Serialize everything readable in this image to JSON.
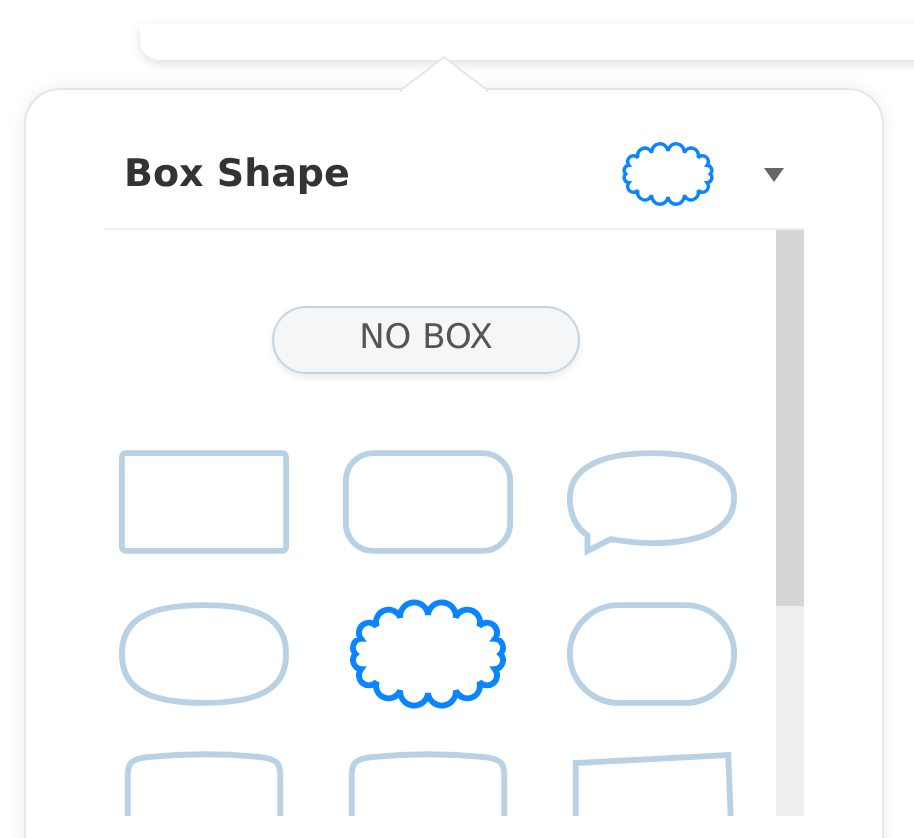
{
  "title": "Box Shape",
  "no_box": {
    "label": "NO BOX"
  },
  "shapes": [
    {
      "kind": "rectangle",
      "selected": false
    },
    {
      "kind": "rounded",
      "selected": false
    },
    {
      "kind": "speech",
      "selected": false
    },
    {
      "kind": "ellipse",
      "selected": false
    },
    {
      "kind": "cloud",
      "selected": true
    },
    {
      "kind": "pill",
      "selected": false
    },
    {
      "kind": "arch",
      "selected": false
    },
    {
      "kind": "arch",
      "selected": false
    },
    {
      "kind": "slanted",
      "selected": false
    }
  ]
}
